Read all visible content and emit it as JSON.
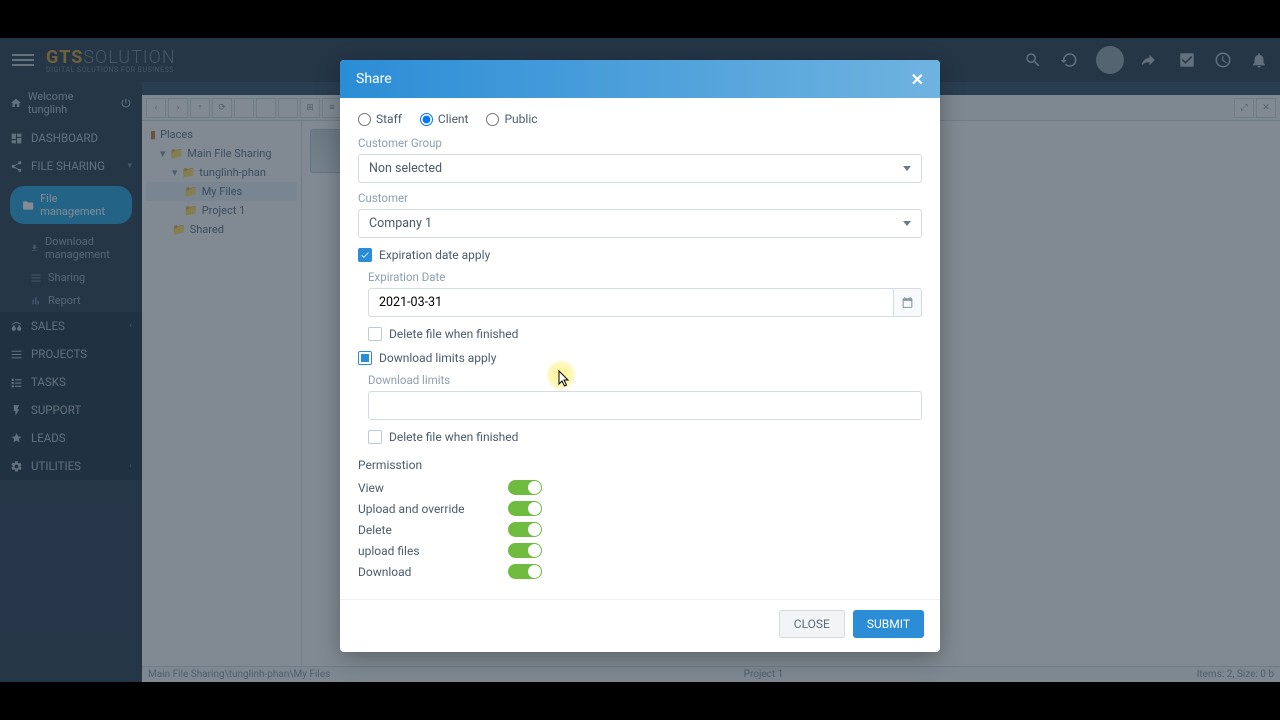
{
  "brand": {
    "main": "GTS",
    "sub": "SOLUTION",
    "tagline": "DIGITAL SOLUTIONS FOR BUSINESS"
  },
  "topbar": {
    "welcome": "Welcome tunglinh"
  },
  "sidebar": {
    "items": [
      {
        "label": "DASHBOARD"
      },
      {
        "label": "FILE SHARING"
      },
      {
        "label": "SALES"
      },
      {
        "label": "PROJECTS"
      },
      {
        "label": "TASKS"
      },
      {
        "label": "SUPPORT"
      },
      {
        "label": "LEADS"
      },
      {
        "label": "UTILITIES"
      }
    ],
    "file_mgmt": "File management",
    "sub": {
      "download_mgmt": "Download management",
      "sharing": "Sharing",
      "report": "Report"
    }
  },
  "tree": {
    "places": "Places",
    "main_file_sharing": "Main File Sharing",
    "user": "tunglinh-phan",
    "my_files": "My Files",
    "project1": "Project 1",
    "shared": "Shared"
  },
  "statusbar": {
    "breadcrumb": "Main File Sharing\\tunglinh-phan\\My Files",
    "center": "Project 1",
    "right": "Items: 2, Size: 0 b"
  },
  "modal": {
    "title": "Share",
    "radios": {
      "staff": "Staff",
      "client": "Client",
      "public": "Public",
      "selected": "client"
    },
    "customer_group_label": "Customer Group",
    "customer_group_value": "Non selected",
    "customer_label": "Customer",
    "customer_value": "Company 1",
    "expiration_apply": "Expiration date apply",
    "expiration_date_label": "Expiration Date",
    "expiration_date_value": "2021-03-31",
    "delete_when_finished": "Delete file when finished",
    "download_limits_apply": "Download limits apply",
    "download_limits_label": "Download limits",
    "download_limits_value": "",
    "permission_label": "Permisstion",
    "perms": {
      "view": "View",
      "upload_override": "Upload and override",
      "delete": "Delete",
      "upload_files": "upload files",
      "download": "Download"
    },
    "close_btn": "CLOSE",
    "submit_btn": "SUBMIT"
  }
}
